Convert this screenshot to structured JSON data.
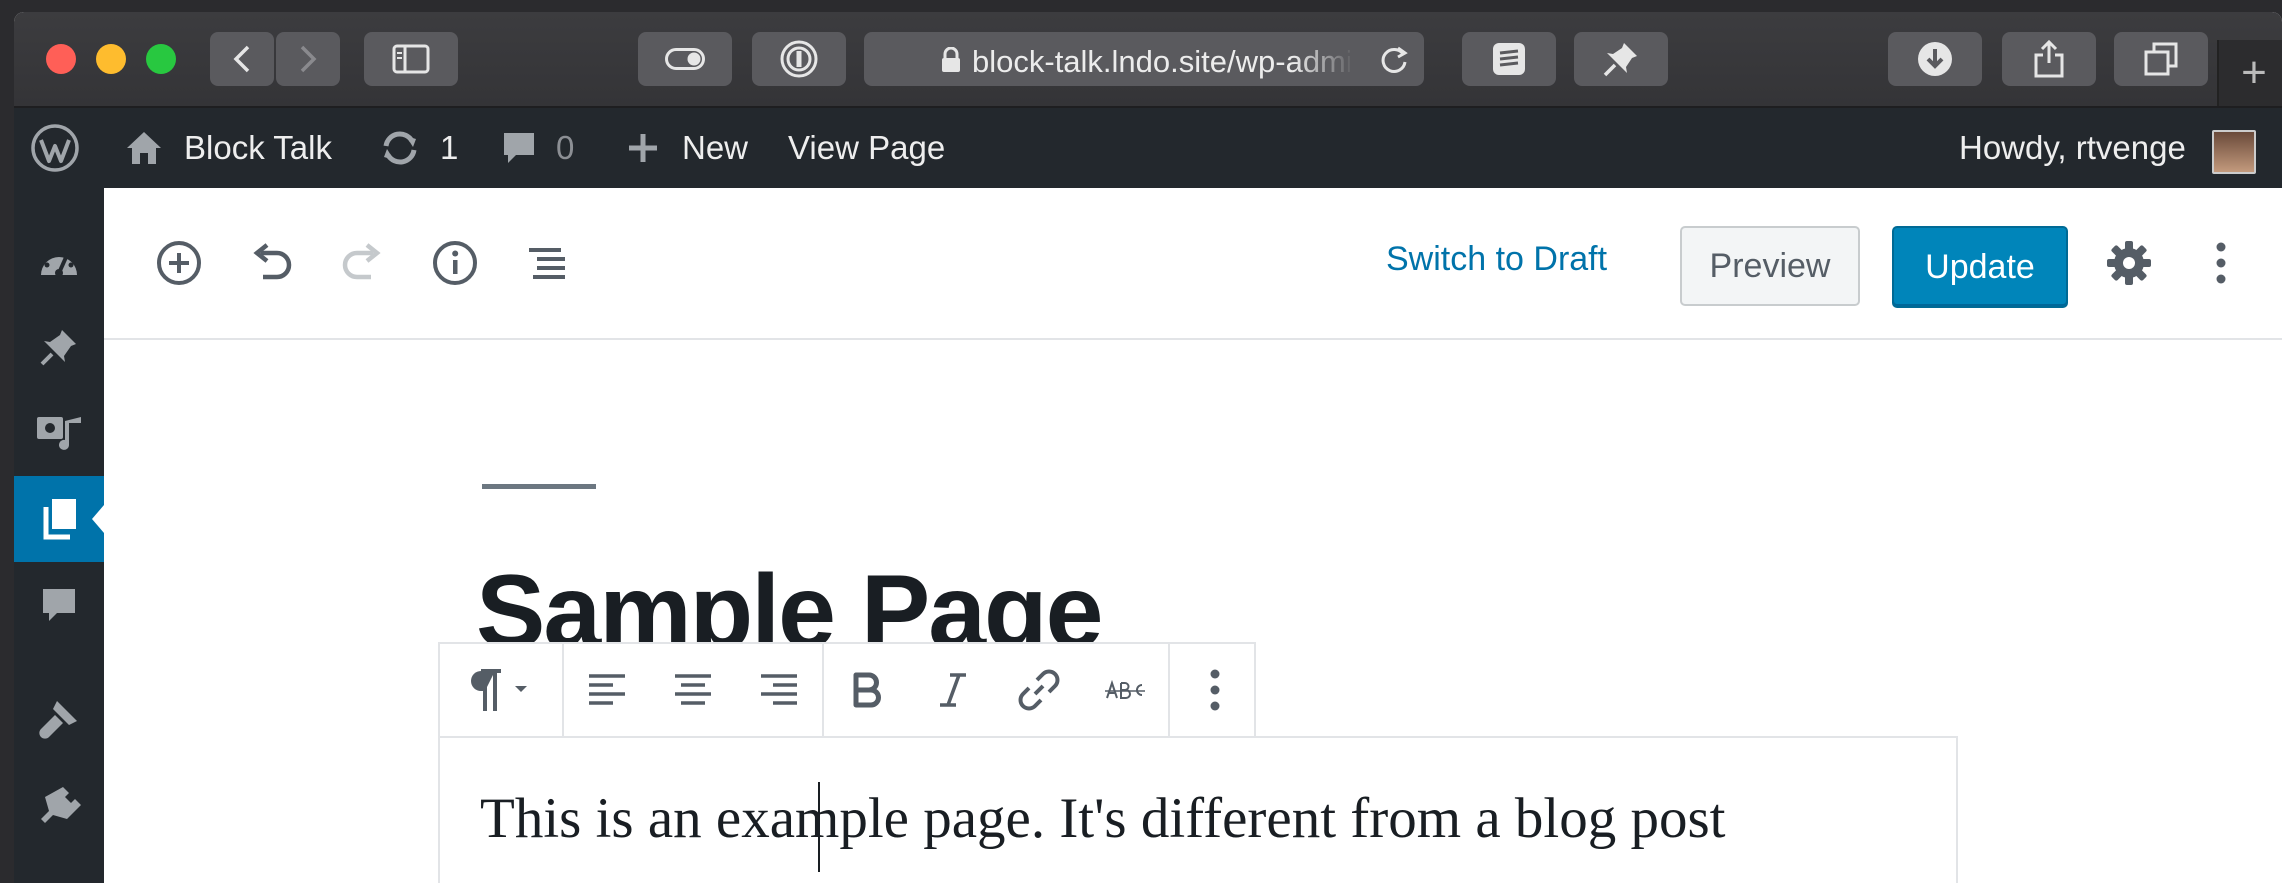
{
  "browser": {
    "url": "block-talk.lndo.site/wp-admin",
    "icons": [
      "back-icon",
      "forward-icon",
      "sidebar-icon",
      "toggle-icon",
      "password-icon",
      "lock-icon",
      "reload-icon",
      "layers-icon",
      "pin-icon",
      "download-icon",
      "share-icon",
      "tabs-icon",
      "plus-icon"
    ]
  },
  "adminbar": {
    "site_name": "Block Talk",
    "updates_count": "1",
    "comments_count": "0",
    "new_label": "New",
    "view_page_label": "View Page",
    "howdy": "Howdy, rtvenge"
  },
  "editor": {
    "switch_to_draft": "Switch to Draft",
    "preview": "Preview",
    "update": "Update"
  },
  "content": {
    "title": "Sample Page",
    "paragraph": "This is an example page. It's different from a blog post"
  },
  "colors": {
    "admin_dark": "#23282d",
    "wp_blue": "#0073aa",
    "update_button": "#0085ba"
  }
}
